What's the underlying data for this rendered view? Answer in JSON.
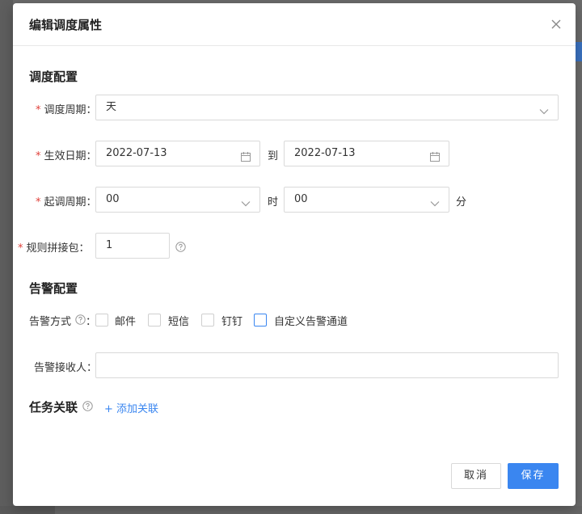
{
  "dialog": {
    "title": "编辑调度属性",
    "close_icon": "close-icon"
  },
  "schedule_section": {
    "title": "调度配置",
    "period": {
      "label": "调度周期：",
      "value": "天",
      "icon": "chevron-down-icon"
    },
    "effective_date": {
      "label": "生效日期：",
      "start": "2022-07-13",
      "to_text": "到",
      "end": "2022-07-13",
      "icon": "calendar-icon"
    },
    "start_period": {
      "label": "起调周期：",
      "hour_value": "00",
      "hour_unit": "时",
      "minute_value": "00",
      "minute_unit": "分"
    },
    "rule_package": {
      "label": "规则拼接包：",
      "value": "1",
      "help_icon": "question-circle-icon"
    }
  },
  "alert_section": {
    "title": "告警配置",
    "method": {
      "label": "告警方式",
      "colon": "：",
      "options": [
        {
          "label": "邮件",
          "checked": false
        },
        {
          "label": "短信",
          "checked": false
        },
        {
          "label": "钉钉",
          "checked": false
        },
        {
          "label": "自定义告警通道",
          "checked": false
        }
      ]
    },
    "receiver": {
      "label": "告警接收人：",
      "value": ""
    }
  },
  "task_section": {
    "title": "任务关联",
    "add_link": "+ 添加关联"
  },
  "footer": {
    "cancel_label": "取消",
    "save_label": "保存"
  },
  "colors": {
    "primary": "#3a86f0",
    "required": "#e0403a",
    "border": "#d9d9d9"
  }
}
